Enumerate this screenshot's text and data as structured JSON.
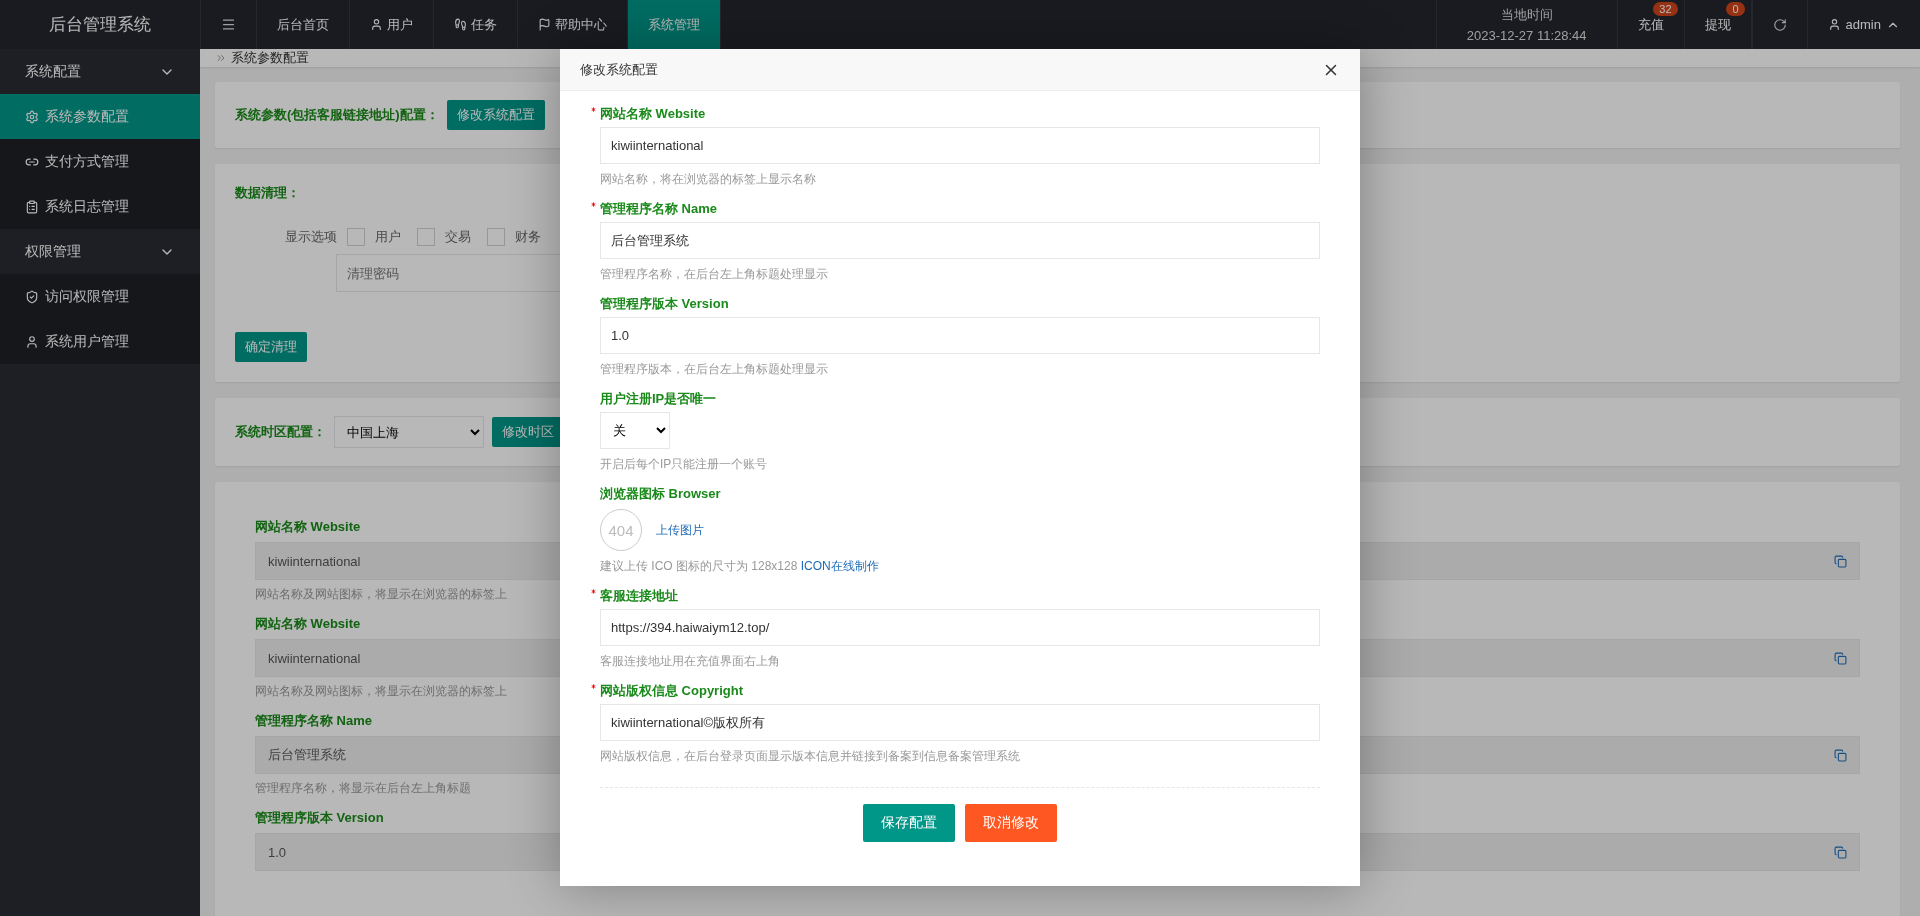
{
  "topbar": {
    "logo": "后台管理系统",
    "nav": [
      {
        "label": "后台首页",
        "selected": false
      },
      {
        "label": "用户",
        "selected": false
      },
      {
        "label": "任务",
        "selected": false
      },
      {
        "label": "帮助中心",
        "selected": false
      },
      {
        "label": "系统管理",
        "selected": true
      }
    ],
    "clock_label": "当地时间",
    "clock_value": "2023-12-27 11:28:44",
    "actions": [
      {
        "label": "充值",
        "badge": "32"
      },
      {
        "label": "提现",
        "badge": "0"
      }
    ],
    "user": "admin"
  },
  "sidebar": [
    {
      "title": "系统配置",
      "expanded": true,
      "children": [
        {
          "label": "系统参数配置",
          "selected": true
        },
        {
          "label": "支付方式管理",
          "selected": false
        },
        {
          "label": "系统日志管理",
          "selected": false
        }
      ]
    },
    {
      "title": "权限管理",
      "expanded": true,
      "children": [
        {
          "label": "访问权限管理",
          "selected": false
        },
        {
          "label": "系统用户管理",
          "selected": false
        }
      ]
    }
  ],
  "breadcrumb": "系统参数配置",
  "params_card": {
    "label": "系统参数(包括客服链接地址)配置：",
    "button": "修改系统配置"
  },
  "clean_card": {
    "title": "数据清理：",
    "options_label": "显示选项",
    "options": [
      {
        "label": "用户",
        "checked": false
      },
      {
        "label": "交易",
        "checked": false
      },
      {
        "label": "财务",
        "checked": false
      }
    ],
    "password_placeholder": "清理密码",
    "button": "确定清理"
  },
  "timezone_card": {
    "label": "系统时区配置：",
    "value": "中国上海",
    "button": "修改时区"
  },
  "settings_list": [
    {
      "label": "网站名称 Website",
      "value": "kiwiinternational",
      "help": "网站名称及网站图标，将显示在浏览器的标签上"
    },
    {
      "label": "网站名称 Website",
      "value": "kiwiinternational",
      "help": "网站名称及网站图标，将显示在浏览器的标签上"
    },
    {
      "label": "管理程序名称 Name",
      "value": "后台管理系统",
      "help": "管理程序名称，将显示在后台左上角标题"
    },
    {
      "label": "管理程序版本 Version",
      "value": "1.0"
    }
  ],
  "modal": {
    "title": "修改系统配置",
    "fields": [
      {
        "kind": "text",
        "required": true,
        "label": "网站名称 Website",
        "value": "kiwiinternational",
        "help": "网站名称，将在浏览器的标签上显示名称"
      },
      {
        "kind": "text",
        "required": true,
        "label": "管理程序名称 Name",
        "value": "后台管理系统",
        "help": "管理程序名称，在后台左上角标题处理显示"
      },
      {
        "kind": "text",
        "required": false,
        "label": "管理程序版本 Version",
        "value": "1.0",
        "help": "管理程序版本，在后台左上角标题处理显示"
      },
      {
        "kind": "select",
        "required": false,
        "label": "用户注册IP是否唯一",
        "value": "关",
        "help": "开启后每个IP只能注册一个账号"
      },
      {
        "kind": "upload",
        "required": false,
        "label": "浏览器图标 Browser",
        "preview": "404",
        "upload": "上传图片",
        "help": "建议上传 ICO 图标的尺寸为 128x128",
        "link": "ICON在线制作"
      },
      {
        "kind": "text",
        "required": true,
        "label": "客服连接地址",
        "value": "https://394.haiwaiym12.top/",
        "help": "客服连接地址用在充值界面右上角"
      },
      {
        "kind": "text",
        "required": true,
        "label": "网站版权信息 Copyright",
        "value": "kiwiinternational©版权所有",
        "help": "网站版权信息，在后台登录页面显示版本信息并链接到备案到信息备案管理系统"
      }
    ],
    "buttons": [
      {
        "kind": "primary",
        "label": "保存配置"
      },
      {
        "kind": "danger",
        "label": "取消修改"
      }
    ]
  }
}
